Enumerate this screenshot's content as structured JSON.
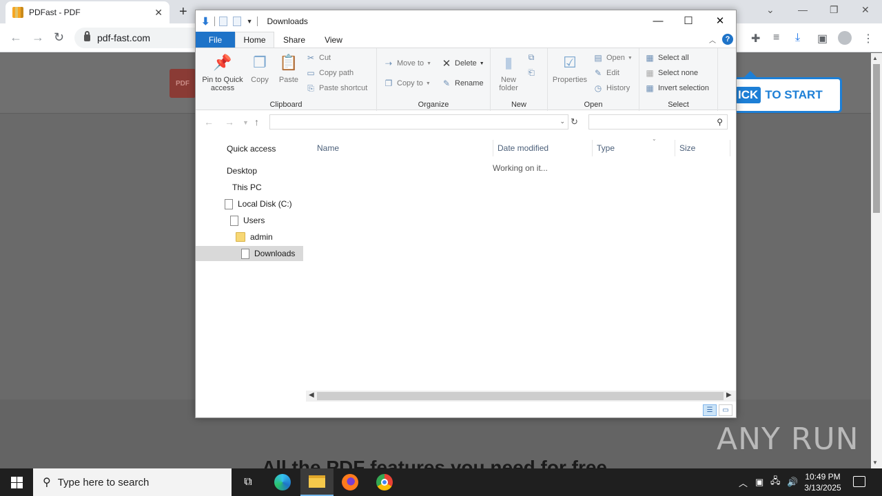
{
  "browser": {
    "tab_title": "PDFast - PDF",
    "tab_close": "✕",
    "new_tab": "+",
    "url": "pdf-fast.com"
  },
  "page": {
    "logo_text": "PDF",
    "cta_highlight": "ICK",
    "cta_text": "TO START",
    "heading": "All the PDF features you need for free",
    "watermark": "ANY RUN"
  },
  "explorer": {
    "title": "Downloads",
    "tabs": {
      "file": "File",
      "home": "Home",
      "share": "Share",
      "view": "View"
    },
    "help": "?",
    "ribbon": {
      "clipboard": {
        "label": "Clipboard",
        "pin": "Pin to Quick access",
        "copy": "Copy",
        "paste": "Paste",
        "cut": "Cut",
        "copy_path": "Copy path",
        "paste_shortcut": "Paste shortcut"
      },
      "organize": {
        "label": "Organize",
        "move_to": "Move to",
        "copy_to": "Copy to",
        "delete": "Delete",
        "rename": "Rename"
      },
      "new": {
        "label": "New",
        "new_folder": "New folder"
      },
      "open": {
        "label": "Open",
        "properties": "Properties",
        "open": "Open",
        "edit": "Edit",
        "history": "History"
      },
      "select": {
        "label": "Select",
        "select_all": "Select all",
        "select_none": "Select none",
        "invert": "Invert selection"
      }
    },
    "address": "",
    "search_placeholder": "",
    "nav": [
      {
        "label": "Quick access"
      },
      {
        "label": "Desktop"
      },
      {
        "label": "This PC"
      },
      {
        "label": "Local Disk (C:)"
      },
      {
        "label": "Users"
      },
      {
        "label": "admin"
      },
      {
        "label": "Downloads"
      }
    ],
    "columns": {
      "name": "Name",
      "date": "Date modified",
      "type": "Type",
      "size": "Size"
    },
    "status_message": "Working on it..."
  },
  "taskbar": {
    "search_placeholder": "Type here to search",
    "time": "10:49 PM",
    "date": "3/13/2025"
  }
}
